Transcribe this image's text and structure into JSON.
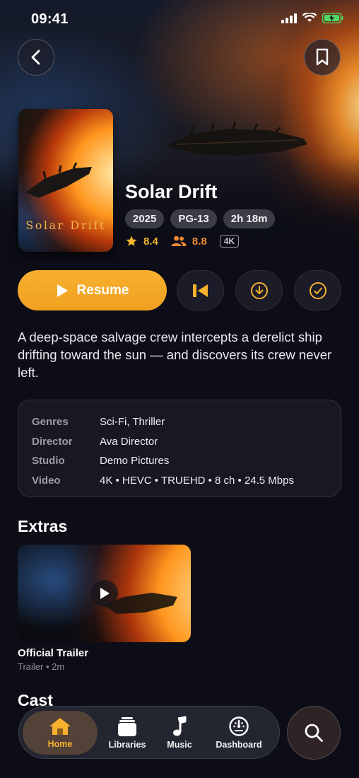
{
  "status_bar": {
    "time": "09:41"
  },
  "header": {
    "back_icon": "chevron-left-icon",
    "bookmark_icon": "bookmark-icon"
  },
  "movie": {
    "title": "Solar Drift",
    "poster_title": "Solar Drift",
    "year": "2025",
    "rating_cert": "PG-13",
    "runtime": "2h 18m",
    "critic_score": "8.4",
    "audience_score": "8.8",
    "quality_badge": "4K",
    "synopsis": "A deep-space salvage crew intercepts a derelict ship drifting toward the sun — and discovers its crew never left."
  },
  "actions": {
    "resume_label": "Resume",
    "restart_icon": "skip-back-icon",
    "download_icon": "download-icon",
    "watched_icon": "check-circle-icon"
  },
  "details": [
    {
      "key": "Genres",
      "value": "Sci-Fi, Thriller"
    },
    {
      "key": "Director",
      "value": "Ava Director"
    },
    {
      "key": "Studio",
      "value": "Demo Pictures"
    },
    {
      "key": "Video",
      "value": "4K • HEVC • TRUEHD • 8 ch • 24.5 Mbps"
    }
  ],
  "extras": {
    "heading": "Extras",
    "items": [
      {
        "title": "Official Trailer",
        "subtitle": "Trailer • 2m"
      }
    ]
  },
  "cast": {
    "heading": "Cast"
  },
  "nav": {
    "items": [
      {
        "label": "Home",
        "icon": "home-icon",
        "active": true
      },
      {
        "label": "Libraries",
        "icon": "libraries-icon",
        "active": false
      },
      {
        "label": "Music",
        "icon": "music-note-icon",
        "active": false
      },
      {
        "label": "Dashboard",
        "icon": "dashboard-icon",
        "active": false
      }
    ],
    "search_icon": "search-icon"
  },
  "colors": {
    "accent": "#f7b12f",
    "background": "#0c0d16",
    "card": "#171824"
  }
}
